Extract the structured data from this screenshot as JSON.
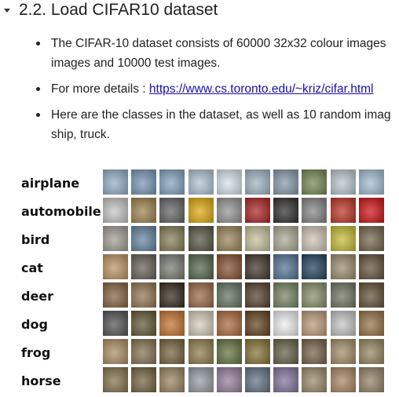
{
  "section": {
    "number": "2.2.",
    "title": "Load CIFAR10 dataset"
  },
  "bullets": {
    "b1_line1": "The CIFAR-10 dataset consists of 60000 32x32 colour images",
    "b1_line2": "images and 10000 test images.",
    "b2_prefix": "For more details : ",
    "b2_link": "https://www.cs.toronto.edu/~kriz/cifar.html",
    "b3_line1": "Here are the classes in the dataset, as well as 10 random imag",
    "b3_line2": "ship, truck."
  },
  "figure": {
    "classes": [
      {
        "name": "airplane",
        "colors": [
          "#9ab4cc",
          "#7f9dbb",
          "#8aa9c4",
          "#b5c8d8",
          "#d9e6ee",
          "#a8b8c6",
          "#8ea0ae",
          "#7b8f5a",
          "#bfcbd4",
          "#a9c2d4"
        ]
      },
      {
        "name": "automobile",
        "colors": [
          "#c9c9c9",
          "#a38a58",
          "#6c6c6c",
          "#e0b020",
          "#9a9a9a",
          "#b03030",
          "#3a3a3a",
          "#8b8b8b",
          "#c04030",
          "#d02020"
        ]
      },
      {
        "name": "bird",
        "colors": [
          "#a7a39a",
          "#6d8aa6",
          "#8c8460",
          "#5e5e4e",
          "#a08c62",
          "#c9c5a2",
          "#b0ae9a",
          "#d2c8b8",
          "#c8c040",
          "#7a6e56"
        ]
      },
      {
        "name": "cat",
        "colors": [
          "#c09a6a",
          "#6e6860",
          "#7c8478",
          "#5e6e56",
          "#8c5a3c",
          "#4a4036",
          "#5c7a9a",
          "#2c4c64",
          "#a09276",
          "#6c5a46"
        ]
      },
      {
        "name": "deer",
        "colors": [
          "#8a6c4c",
          "#9a7c5a",
          "#3c3428",
          "#a07050",
          "#6a7c6a",
          "#5c4a38",
          "#7a8a6a",
          "#8e9470",
          "#787a6a",
          "#6a5a40"
        ]
      },
      {
        "name": "dog",
        "colors": [
          "#5c5c5c",
          "#6a6040",
          "#c87a3c",
          "#d8d0c0",
          "#b07048",
          "#6a4a2c",
          "#f0f0f0",
          "#c0a080",
          "#c8c8c8",
          "#9a7a50"
        ]
      },
      {
        "name": "frog",
        "colors": [
          "#b0946c",
          "#8a7a5a",
          "#7a6a48",
          "#968454",
          "#6c7a4a",
          "#8a7a40",
          "#6e6850",
          "#7c6a50",
          "#a89470",
          "#9c8c6a"
        ]
      },
      {
        "name": "horse",
        "colors": [
          "#8c7858",
          "#7a6c4a",
          "#a08a6a",
          "#9aa2a8",
          "#9c86a0",
          "#6c7a8a",
          "#8a7ca0",
          "#a09070",
          "#b08c6c",
          "#9a8a70"
        ]
      }
    ]
  }
}
